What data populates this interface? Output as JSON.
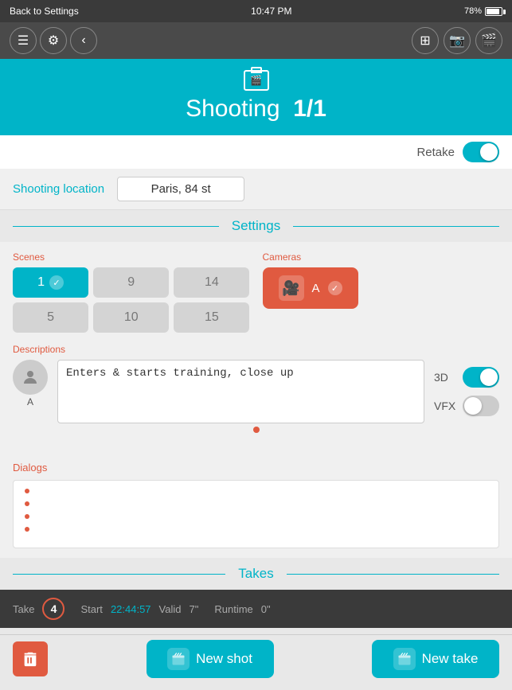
{
  "statusBar": {
    "backLabel": "Back to Settings",
    "time": "10:47 PM",
    "battery": "78%"
  },
  "header": {
    "titlePrefix": "Shooting",
    "titleBold": "1/1",
    "retakeLabel": "Retake",
    "retakeOn": true
  },
  "location": {
    "label": "Shooting location",
    "value": "Paris, 84 st"
  },
  "settings": {
    "title": "Settings",
    "scenes": {
      "label": "Scenes",
      "buttons": [
        {
          "value": "1",
          "active": true
        },
        {
          "value": "9",
          "active": false
        },
        {
          "value": "14",
          "active": false
        },
        {
          "value": "5",
          "active": false
        },
        {
          "value": "10",
          "active": false
        },
        {
          "value": "15",
          "active": false
        }
      ]
    },
    "cameras": {
      "label": "Cameras",
      "value": "A"
    },
    "descriptions": {
      "label": "Descriptions",
      "avatarLabel": "A",
      "text": "Enters & starts training, close up",
      "toggle3D": {
        "label": "3D",
        "on": true
      },
      "toggleVFX": {
        "label": "VFX",
        "on": false
      }
    }
  },
  "dialogs": {
    "label": "Dialogs",
    "items": [
      "",
      "",
      "",
      ""
    ]
  },
  "takes": {
    "title": "Takes",
    "row": {
      "takeLabel": "Take",
      "takeNumber": "4",
      "startLabel": "Start",
      "startValue": "22:44:57",
      "validLabel": "Valid",
      "validValue": "7\"",
      "runtimeLabel": "Runtime",
      "runtimeValue": "0\""
    }
  },
  "bottomBar": {
    "newShotLabel": "New shot",
    "newTakeLabel": "New take"
  }
}
